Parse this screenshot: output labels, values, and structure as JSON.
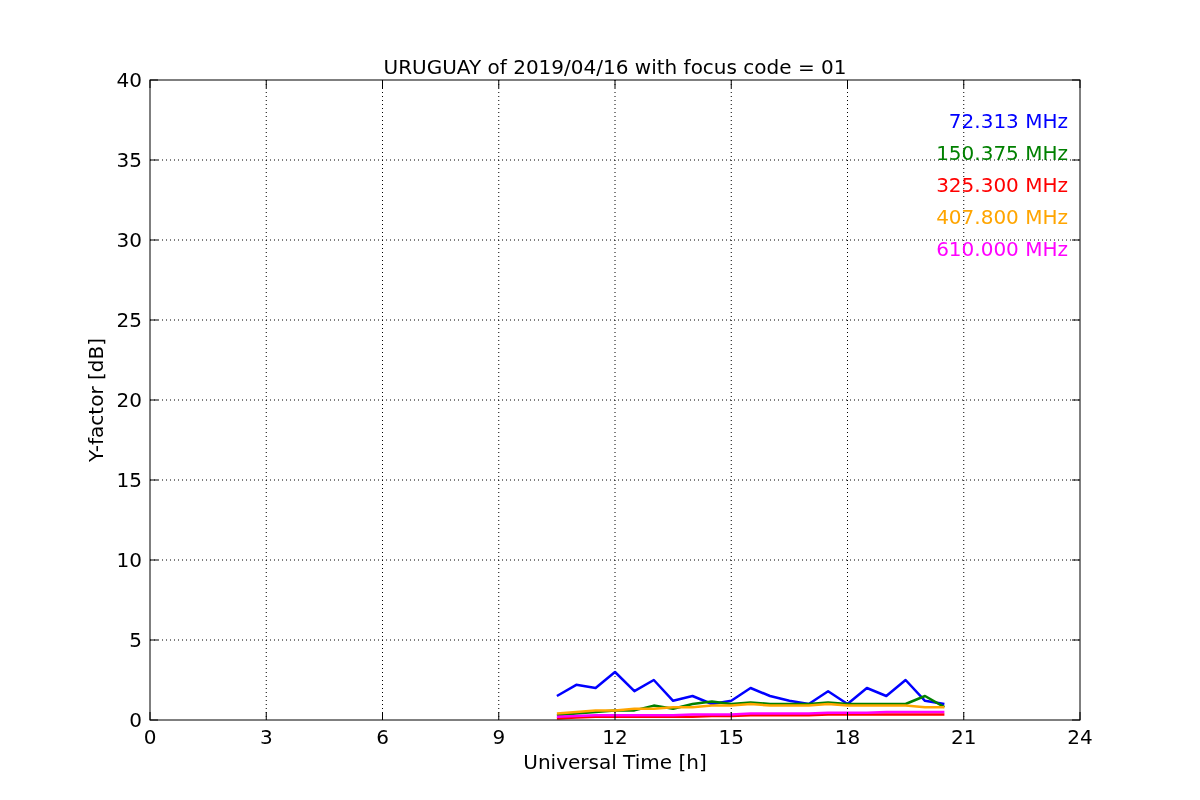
{
  "figure": {
    "chart_data": {
      "type": "line",
      "title": "URUGUAY of 2019/04/16 with focus code = 01",
      "xlabel": "Universal Time [h]",
      "ylabel": "Y-factor [dB]",
      "x": [
        10.5,
        11,
        11.5,
        12,
        12.5,
        13,
        13.5,
        14,
        14.5,
        15,
        15.5,
        16,
        16.5,
        17,
        17.5,
        18,
        18.5,
        19,
        19.5,
        20,
        20.5
      ],
      "series": [
        {
          "name": "72.313 MHz",
          "color": "#0000ff",
          "values": [
            1.5,
            2.2,
            2.0,
            3.0,
            1.8,
            2.5,
            1.2,
            1.5,
            1.0,
            1.2,
            2.0,
            1.5,
            1.2,
            1.0,
            1.8,
            1.0,
            2.0,
            1.5,
            2.5,
            1.2,
            1.0
          ]
        },
        {
          "name": "150.375 MHz",
          "color": "#008000",
          "values": [
            0.3,
            0.4,
            0.5,
            0.6,
            0.6,
            0.9,
            0.7,
            1.0,
            1.15,
            1.0,
            1.1,
            1.0,
            1.0,
            1.0,
            1.1,
            1.0,
            1.0,
            1.0,
            1.0,
            1.5,
            0.8
          ]
        },
        {
          "name": "325.300 MHz",
          "color": "#ff0000",
          "values": [
            0.1,
            0.15,
            0.2,
            0.2,
            0.2,
            0.2,
            0.2,
            0.2,
            0.25,
            0.25,
            0.3,
            0.3,
            0.3,
            0.3,
            0.35,
            0.35,
            0.35,
            0.35,
            0.35,
            0.35,
            0.35
          ]
        },
        {
          "name": "407.800 MHz",
          "color": "#ffa500",
          "values": [
            0.4,
            0.5,
            0.6,
            0.6,
            0.7,
            0.7,
            0.8,
            0.8,
            0.9,
            0.9,
            1.0,
            0.9,
            0.9,
            0.9,
            1.0,
            0.9,
            0.9,
            0.9,
            0.9,
            0.8,
            0.8
          ]
        },
        {
          "name": "610.000 MHz",
          "color": "#ff00ff",
          "values": [
            0.2,
            0.25,
            0.3,
            0.3,
            0.3,
            0.3,
            0.3,
            0.35,
            0.35,
            0.35,
            0.4,
            0.4,
            0.4,
            0.4,
            0.45,
            0.45,
            0.45,
            0.5,
            0.5,
            0.5,
            0.5
          ]
        }
      ],
      "grid": true,
      "xlim": [
        0,
        24
      ],
      "ylim": [
        0,
        40
      ],
      "xticks": [
        0,
        3,
        6,
        9,
        12,
        15,
        18,
        21,
        24
      ],
      "yticks": [
        0,
        5,
        10,
        15,
        20,
        25,
        30,
        35,
        40
      ]
    }
  }
}
